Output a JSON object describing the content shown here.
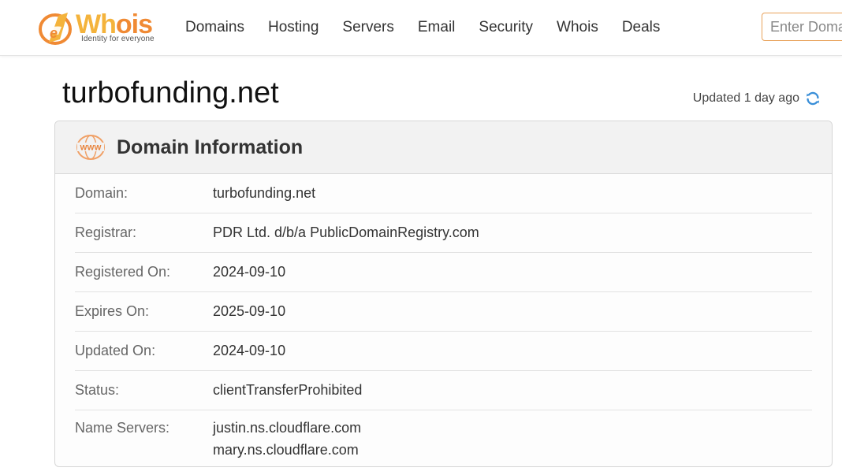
{
  "logo": {
    "brand_part1": "Wh",
    "brand_part2": "ois",
    "tagline": "Identity for everyone",
    "colors": {
      "primary": "#f4b33c",
      "accent": "#f08a34"
    }
  },
  "nav": {
    "items": [
      "Domains",
      "Hosting",
      "Servers",
      "Email",
      "Security",
      "Whois",
      "Deals"
    ]
  },
  "search": {
    "placeholder": "Enter Domain",
    "value": ""
  },
  "page": {
    "title": "turbofunding.net",
    "updated_text": "Updated 1 day ago",
    "refresh_icon": "refresh-icon"
  },
  "domain_info": {
    "icon": "www-icon",
    "heading": "Domain Information",
    "rows": [
      {
        "label": "Domain:",
        "value": "turbofunding.net"
      },
      {
        "label": "Registrar:",
        "value": "PDR Ltd. d/b/a PublicDomainRegistry.com"
      },
      {
        "label": "Registered On:",
        "value": "2024-09-10"
      },
      {
        "label": "Expires On:",
        "value": "2025-09-10"
      },
      {
        "label": "Updated On:",
        "value": "2024-09-10"
      },
      {
        "label": "Status:",
        "value": "clientTransferProhibited"
      }
    ],
    "name_servers": {
      "label": "Name Servers:",
      "values": [
        "justin.ns.cloudflare.com",
        "mary.ns.cloudflare.com"
      ]
    }
  }
}
